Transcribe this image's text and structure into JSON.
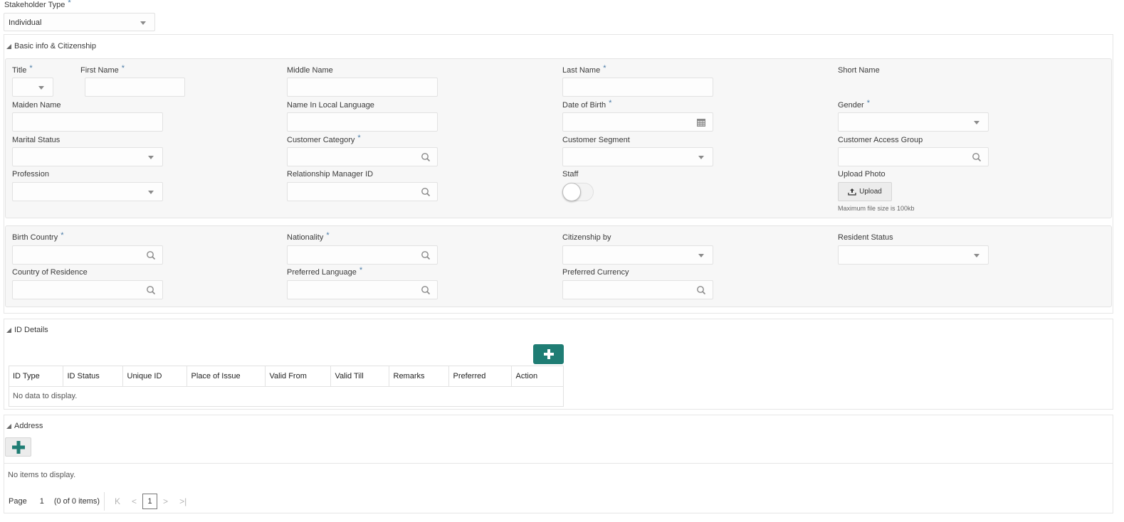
{
  "stakeholder": {
    "label": "Stakeholder Type",
    "required_mark": "*",
    "value": "Individual"
  },
  "sections": {
    "basic_info": {
      "title": "Basic info & Citizenship"
    },
    "id_details": {
      "title": "ID Details"
    },
    "address": {
      "title": "Address"
    }
  },
  "basic_fields": {
    "title": {
      "label": "Title",
      "required": "*"
    },
    "first_name": {
      "label": "First Name",
      "required": "*"
    },
    "middle_name": {
      "label": "Middle Name"
    },
    "last_name": {
      "label": "Last Name",
      "required": "*"
    },
    "short_name": {
      "label": "Short Name"
    },
    "maiden_name": {
      "label": "Maiden Name"
    },
    "local_name": {
      "label": "Name In Local Language"
    },
    "dob": {
      "label": "Date of Birth",
      "required": "*"
    },
    "gender": {
      "label": "Gender",
      "required": "*"
    },
    "marital_status": {
      "label": "Marital Status"
    },
    "customer_category": {
      "label": "Customer Category",
      "required": "*"
    },
    "customer_segment": {
      "label": "Customer Segment"
    },
    "customer_access_group": {
      "label": "Customer Access Group"
    },
    "profession": {
      "label": "Profession"
    },
    "rm_id": {
      "label": "Relationship Manager ID"
    },
    "staff": {
      "label": "Staff",
      "on": false
    },
    "upload_photo": {
      "label": "Upload Photo",
      "button": "Upload",
      "hint": "Maximum file size is 100kb"
    }
  },
  "citizenship_fields": {
    "birth_country": {
      "label": "Birth Country",
      "required": "*"
    },
    "nationality": {
      "label": "Nationality",
      "required": "*"
    },
    "citizenship_by": {
      "label": "Citizenship by"
    },
    "resident_status": {
      "label": "Resident Status"
    },
    "country_of_residence": {
      "label": "Country of Residence"
    },
    "preferred_language": {
      "label": "Preferred Language",
      "required": "*"
    },
    "preferred_currency": {
      "label": "Preferred Currency"
    }
  },
  "id_table": {
    "columns": [
      "ID Type",
      "ID Status",
      "Unique ID",
      "Place of Issue",
      "Valid From",
      "Valid Till",
      "Remarks",
      "Preferred",
      "Action"
    ],
    "empty_text": "No data to display."
  },
  "address_list": {
    "empty_text": "No items to display.",
    "pager": {
      "page_label": "Page",
      "page": "1",
      "summary": "(0 of 0 items)",
      "current": "1"
    }
  },
  "colors": {
    "accent_teal": "#1f7d74",
    "required_mark": "#4a7ba6"
  }
}
